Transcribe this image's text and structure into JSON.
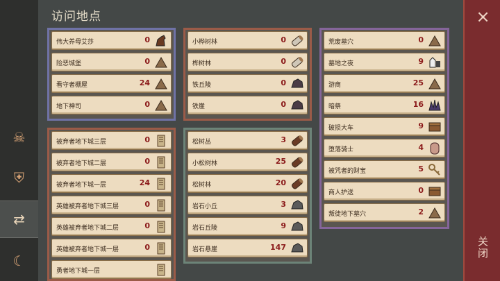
{
  "title": "访问地点",
  "close_label": "关闭",
  "close_icon": "×",
  "side_icons": [
    "skull-icon",
    "shield-icon",
    "signpost-icon",
    "bow-icon"
  ],
  "panels": [
    {
      "color": "blue",
      "rows": [
        {
          "name": "伟大养母艾莎",
          "count": "0",
          "icon": "horse-icon"
        },
        {
          "name": "险恶城堡",
          "count": "0",
          "icon": "castle-icon"
        },
        {
          "name": "看守者棚屋",
          "count": "24",
          "icon": "hut-icon"
        },
        {
          "name": "地下神司",
          "count": "0",
          "icon": "temple-icon"
        }
      ]
    },
    {
      "color": "red",
      "rows": [
        {
          "name": "小桦树林",
          "count": "0",
          "icon": "birch-log-icon"
        },
        {
          "name": "桦树林",
          "count": "0",
          "icon": "birch-log-icon"
        },
        {
          "name": "铁丘陵",
          "count": "0",
          "icon": "iron-ore-icon"
        },
        {
          "name": "铁崖",
          "count": "0",
          "icon": "iron-ore-icon"
        }
      ]
    },
    {
      "color": "purple",
      "rows": [
        {
          "name": "荒废墓穴",
          "count": "0",
          "icon": "crypt-icon"
        },
        {
          "name": "墓地之夜",
          "count": "9",
          "icon": "graveyard-icon"
        },
        {
          "name": "游商",
          "count": "25",
          "icon": "merchant-icon"
        },
        {
          "name": "暗祭",
          "count": "16",
          "icon": "ritual-icon"
        },
        {
          "name": "破损大车",
          "count": "9",
          "icon": "cart-icon"
        },
        {
          "name": "堕落骑士",
          "count": "4",
          "icon": "knight-icon"
        },
        {
          "name": "被咒者的财宝",
          "count": "5",
          "icon": "key-icon"
        },
        {
          "name": "商人护送",
          "count": "0",
          "icon": "chest-icon"
        },
        {
          "name": "叛徒地下墓穴",
          "count": "2",
          "icon": "tent-icon"
        }
      ]
    },
    {
      "color": "red",
      "rows": [
        {
          "name": "被弃者地下城三层",
          "count": "0",
          "icon": "dungeon-icon"
        },
        {
          "name": "被弃者地下城二层",
          "count": "0",
          "icon": "dungeon-icon"
        },
        {
          "name": "被弃者地下城一层",
          "count": "24",
          "icon": "dungeon-icon"
        },
        {
          "name": "英雄被弃者地下城三层",
          "count": "0",
          "icon": "dungeon-icon"
        },
        {
          "name": "英雄被弃者地下城二层",
          "count": "0",
          "icon": "dungeon-icon"
        },
        {
          "name": "英雄被弃者地下城一层",
          "count": "0",
          "icon": "dungeon-icon"
        },
        {
          "name": "勇者地下城一层",
          "count": "",
          "icon": "dungeon-icon"
        }
      ]
    },
    {
      "color": "green",
      "rows": [
        {
          "name": "松树丛",
          "count": "3",
          "icon": "pine-log-icon"
        },
        {
          "name": "小松树林",
          "count": "25",
          "icon": "pine-log-icon"
        },
        {
          "name": "松树林",
          "count": "20",
          "icon": "pine-log-icon"
        },
        {
          "name": "岩石小丘",
          "count": "3",
          "icon": "stone-icon"
        },
        {
          "name": "岩石丘陵",
          "count": "9",
          "icon": "stone-icon"
        },
        {
          "name": "岩石悬崖",
          "count": "147",
          "icon": "stone-icon"
        }
      ]
    }
  ]
}
